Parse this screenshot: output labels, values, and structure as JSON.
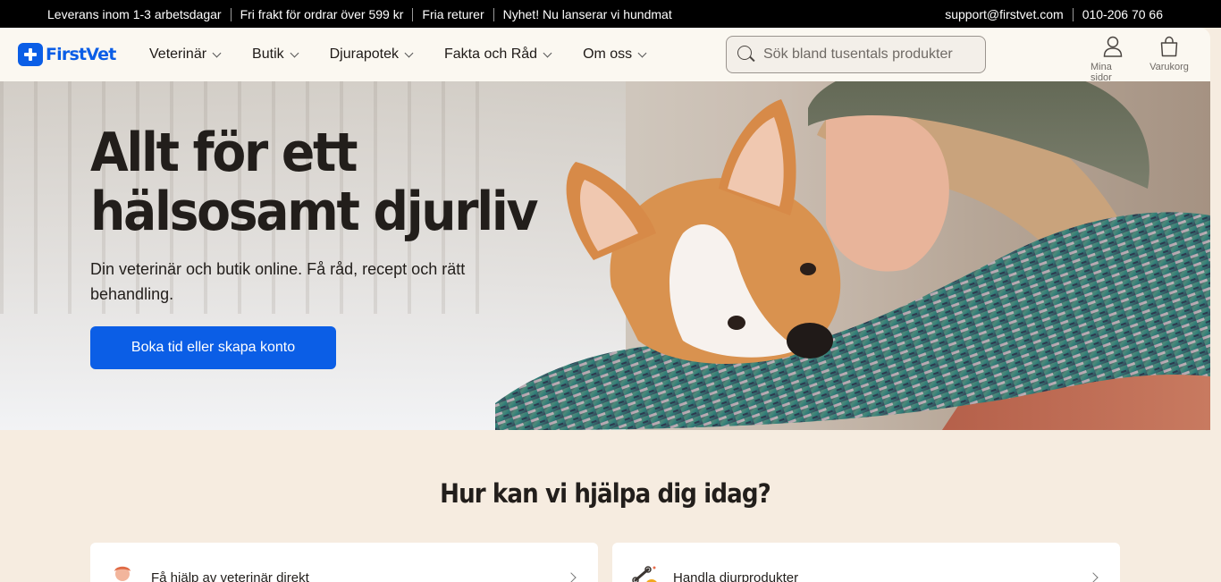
{
  "topbar": {
    "items": [
      "Leverans inom 1-3 arbetsdagar",
      "Fri frakt för ordrar över 599 kr",
      "Fria returer",
      "Nyhet! Nu lanserar vi hundmat"
    ],
    "email": "support@firstvet.com",
    "phone": "010-206 70 66"
  },
  "header": {
    "logo_text": "FirstVet",
    "nav": [
      {
        "label": "Veterinär",
        "icon": "chevron-down-icon"
      },
      {
        "label": "Butik",
        "icon": "chevron-down-icon"
      },
      {
        "label": "Djurapotek",
        "icon": "chevron-down-icon"
      },
      {
        "label": "Fakta och Råd",
        "icon": "chevron-down-icon"
      },
      {
        "label": "Om oss",
        "icon": "chevron-down-icon"
      }
    ],
    "search_placeholder": "Sök bland tusentals produkter",
    "user_label": "Mina sidor",
    "cart_label": "Varukorg"
  },
  "hero": {
    "title_line1": "Allt för ett",
    "title_line2": "hälsosamt djurliv",
    "subtitle": "Din veterinär och butik online. Få råd, recept och rätt behandling.",
    "cta_label": "Boka tid eller skapa konto"
  },
  "help": {
    "title": "Hur kan vi hjälpa dig idag?",
    "cards": [
      {
        "label": "Få hjälp av veterinär direkt",
        "icon": "vet-avatar-icon"
      },
      {
        "label": "Handla djurprodukter",
        "icon": "pet-products-icon"
      }
    ]
  },
  "colors": {
    "brand_blue": "#0b5ee6",
    "background": "#f6ece0",
    "topbar": "#000000"
  }
}
